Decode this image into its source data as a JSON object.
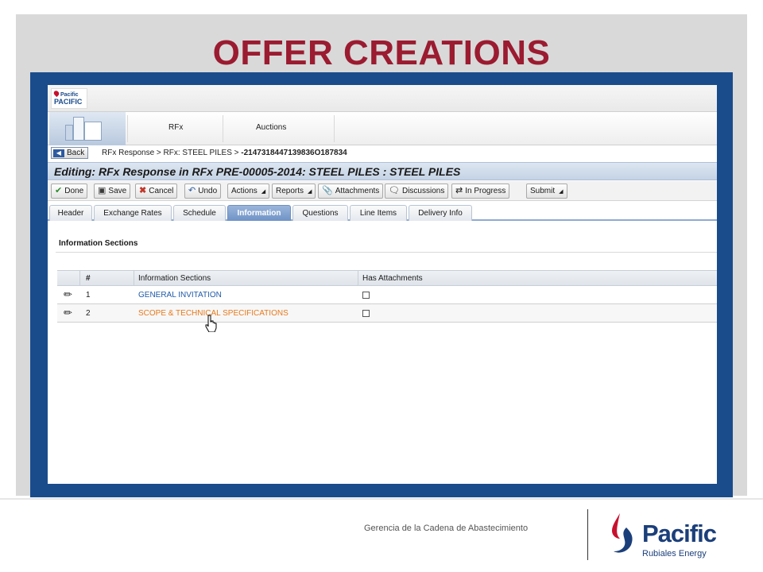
{
  "slide": {
    "title": "OFFER CREATIONS",
    "footer_text": "Gerencia de la Cadena de Abastecimiento",
    "brand": {
      "name": "Pacific",
      "tagline": "Rubiales Energy",
      "drop_color": "#c8102e",
      "text_color": "#1b3f7a"
    },
    "title_color": "#9b1b30",
    "frame_color": "#1a4c8c"
  },
  "app": {
    "logo_text": [
      "Pacific",
      "PACIFIC"
    ],
    "nav": {
      "tabs": [
        "RFx",
        "Auctions"
      ]
    },
    "back_label": "Back",
    "breadcrumb": {
      "item1": "RFx Response",
      "sep": ">",
      "item2": "RFx: STEEL PILES",
      "item3": "-2147318447139836O187834"
    },
    "page_title": "Editing: RFx Response in RFx PRE-00005-2014: STEEL PILES : STEEL PILES",
    "toolbar": {
      "done": "Done",
      "save": "Save",
      "cancel": "Cancel",
      "undo": "Undo",
      "actions": "Actions",
      "reports": "Reports",
      "attachments": "Attachments",
      "discussions": "Discussions",
      "in_progress": "In Progress",
      "submit": "Submit"
    },
    "tabs": [
      "Header",
      "Exchange Rates",
      "Schedule",
      "Information",
      "Questions",
      "Line Items",
      "Delivery Info"
    ],
    "active_tab": "Information",
    "section_heading": "Information Sections",
    "grid": {
      "columns": [
        "#",
        "Information Sections",
        "Has Attachments"
      ],
      "rows": [
        {
          "num": "1",
          "section": "GENERAL INVITATION",
          "has_attachments": false
        },
        {
          "num": "2",
          "section": "SCOPE & TECHNICAL SPECIFICATIONS",
          "has_attachments": false
        }
      ]
    }
  }
}
